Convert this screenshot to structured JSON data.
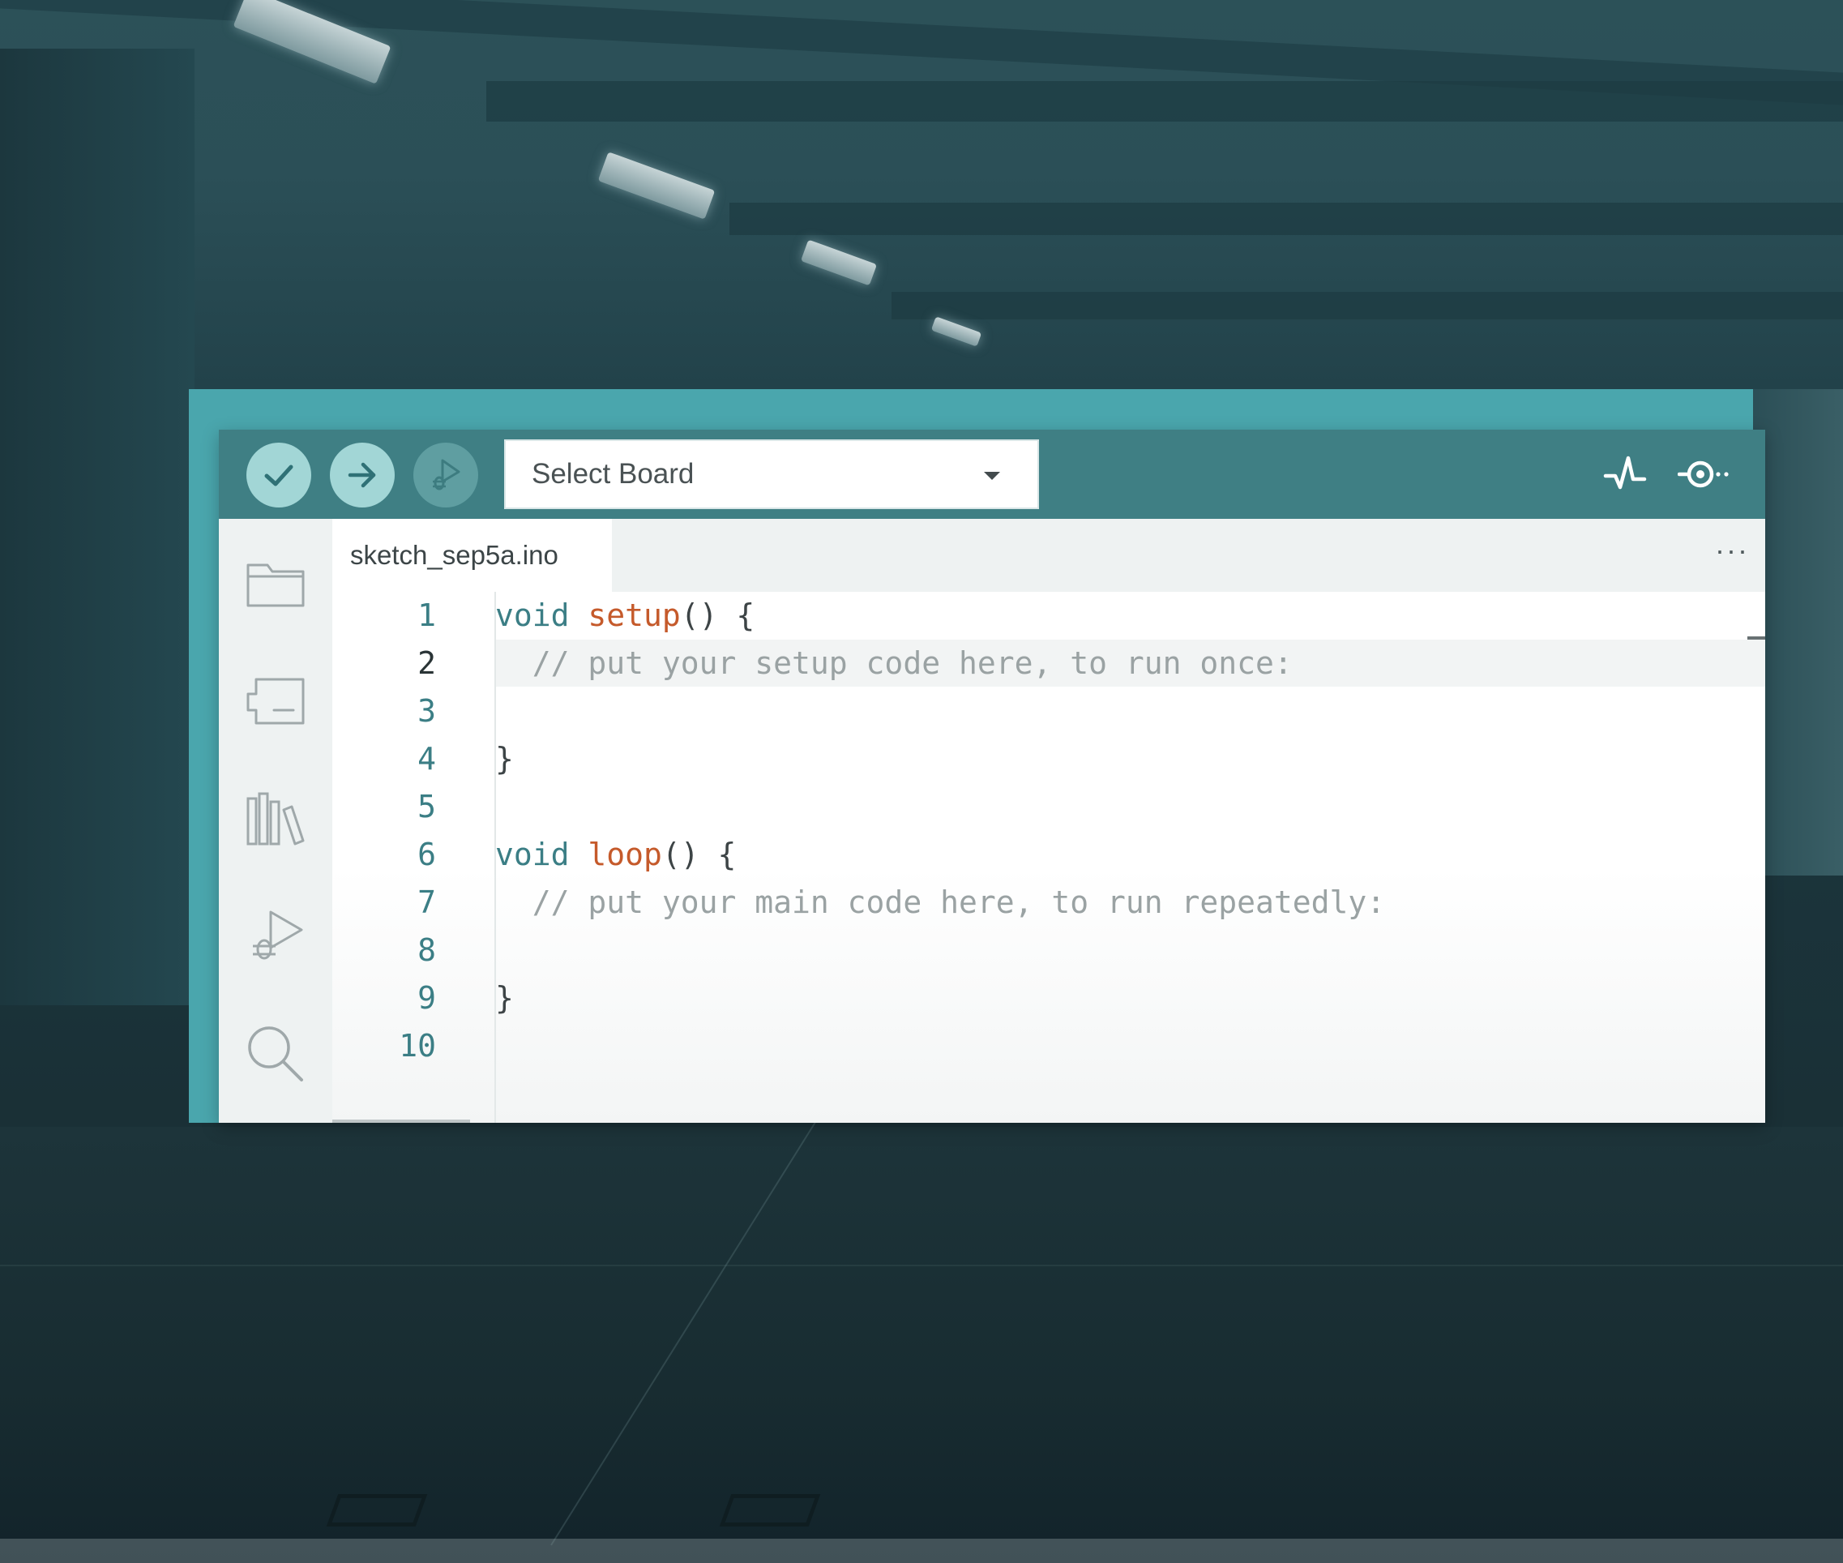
{
  "toolbar": {
    "verify_icon": "check-icon",
    "upload_icon": "arrow-right-icon",
    "debug_icon": "debug-icon",
    "board_select": {
      "label": "Select Board",
      "icon": "caret-down-icon"
    },
    "serial_plotter_icon": "pulse-icon",
    "serial_monitor_icon": "serial-monitor-icon"
  },
  "sidebar": {
    "items": [
      {
        "name": "sketchbook",
        "icon": "folder-icon"
      },
      {
        "name": "boards-manager",
        "icon": "board-icon"
      },
      {
        "name": "library-manager",
        "icon": "library-icon"
      },
      {
        "name": "debug",
        "icon": "debug-icon"
      },
      {
        "name": "search",
        "icon": "search-icon"
      }
    ]
  },
  "tabs": [
    {
      "label": "sketch_sep5a.ino"
    }
  ],
  "tab_more": "···",
  "editor": {
    "active_line": 2,
    "lines": [
      {
        "number": "1",
        "tokens": [
          {
            "t": "kw",
            "text": "void"
          },
          {
            "t": "pl",
            "text": " "
          },
          {
            "t": "fn",
            "text": "setup"
          },
          {
            "t": "pl",
            "text": "() {"
          }
        ]
      },
      {
        "number": "2",
        "tokens": [
          {
            "t": "cm",
            "text": "  // put your setup code here, to run once:"
          }
        ]
      },
      {
        "number": "3",
        "tokens": []
      },
      {
        "number": "4",
        "tokens": [
          {
            "t": "pl",
            "text": "}"
          }
        ]
      },
      {
        "number": "5",
        "tokens": []
      },
      {
        "number": "6",
        "tokens": [
          {
            "t": "kw",
            "text": "void"
          },
          {
            "t": "pl",
            "text": " "
          },
          {
            "t": "fn",
            "text": "loop"
          },
          {
            "t": "pl",
            "text": "() {"
          }
        ]
      },
      {
        "number": "7",
        "tokens": [
          {
            "t": "cm",
            "text": "  // put your main code here, to run repeatedly:"
          }
        ]
      },
      {
        "number": "8",
        "tokens": []
      },
      {
        "number": "9",
        "tokens": [
          {
            "t": "pl",
            "text": "}"
          }
        ]
      },
      {
        "number": "10",
        "tokens": []
      }
    ]
  },
  "colors": {
    "toolbar": "#3f7f84",
    "accent_button": "#a2d6d6",
    "keyword": "#3b7e85",
    "function": "#c55a2b",
    "comment": "#9aa2a3"
  }
}
